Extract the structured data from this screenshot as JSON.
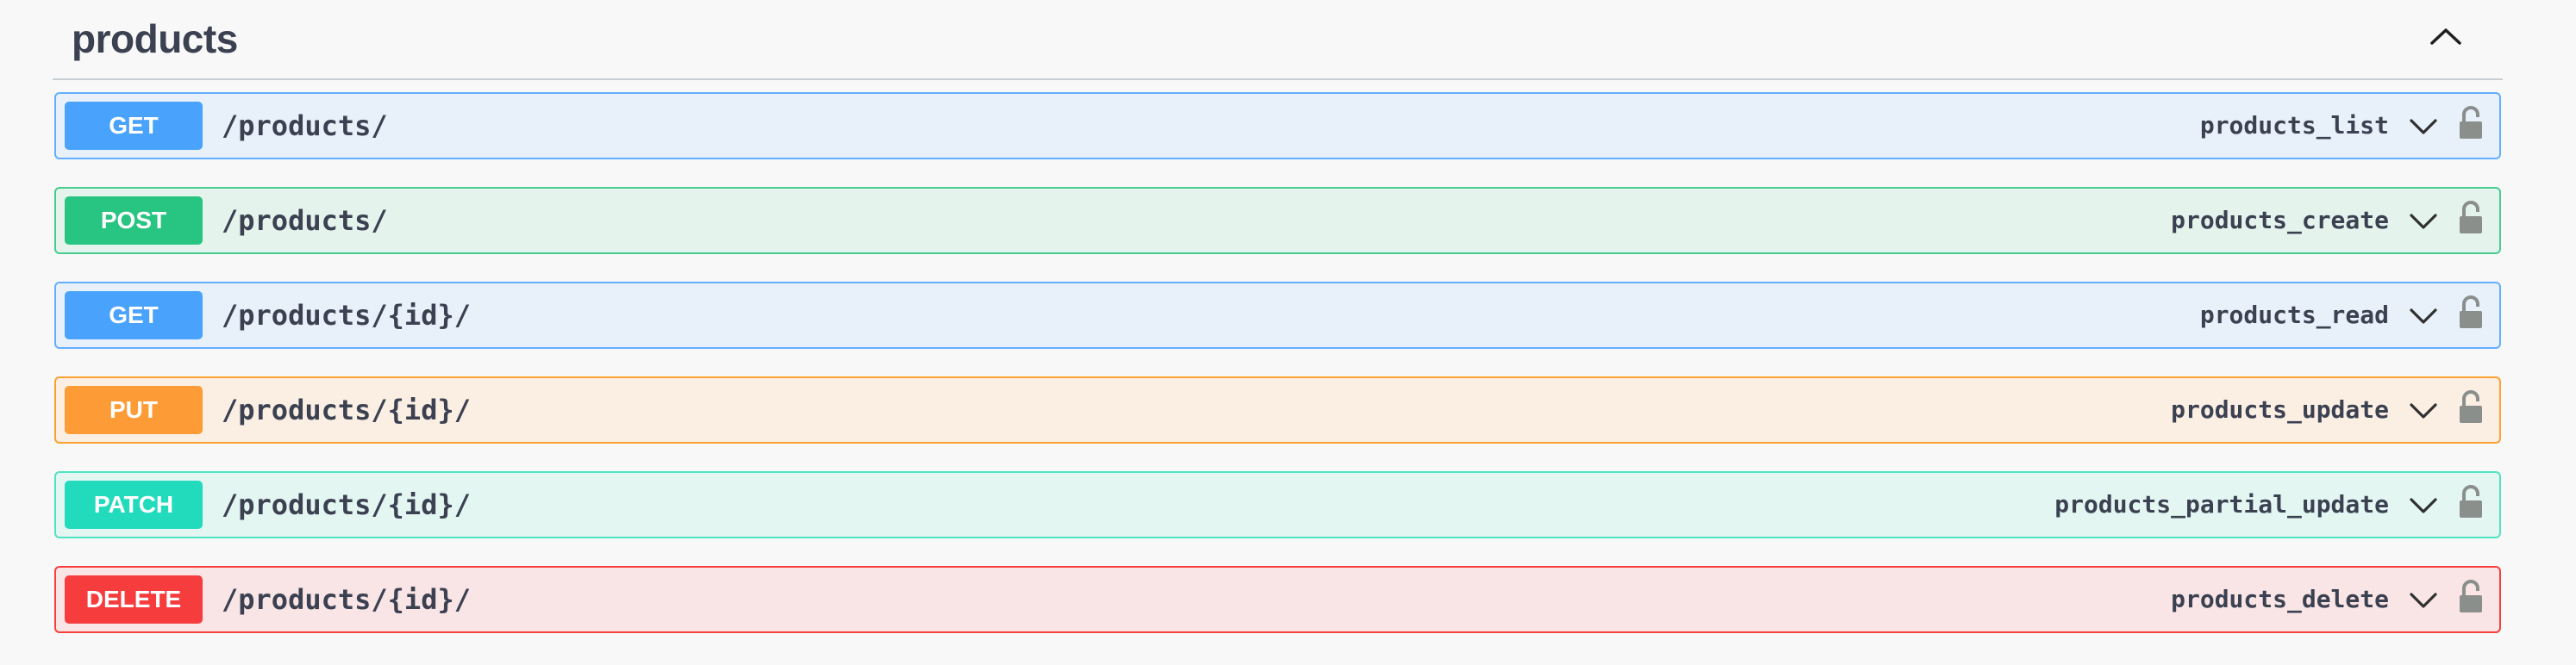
{
  "section": {
    "title": "products",
    "toggle_icon": "chevron-up-icon"
  },
  "operations": [
    {
      "method": "GET",
      "path": "/products/",
      "operation_id": "products_list",
      "color": "#61affe"
    },
    {
      "method": "POST",
      "path": "/products/",
      "operation_id": "products_create",
      "color": "#49cc90"
    },
    {
      "method": "GET",
      "path": "/products/{id}/",
      "operation_id": "products_read",
      "color": "#61affe"
    },
    {
      "method": "PUT",
      "path": "/products/{id}/",
      "operation_id": "products_update",
      "color": "#fca130"
    },
    {
      "method": "PATCH",
      "path": "/products/{id}/",
      "operation_id": "products_partial_update",
      "color": "#50e3c2"
    },
    {
      "method": "DELETE",
      "path": "/products/{id}/",
      "operation_id": "products_delete",
      "color": "#f93e3e"
    }
  ],
  "icons": {
    "expand": "chevron-down-icon",
    "auth": "unlocked-padlock-icon"
  }
}
